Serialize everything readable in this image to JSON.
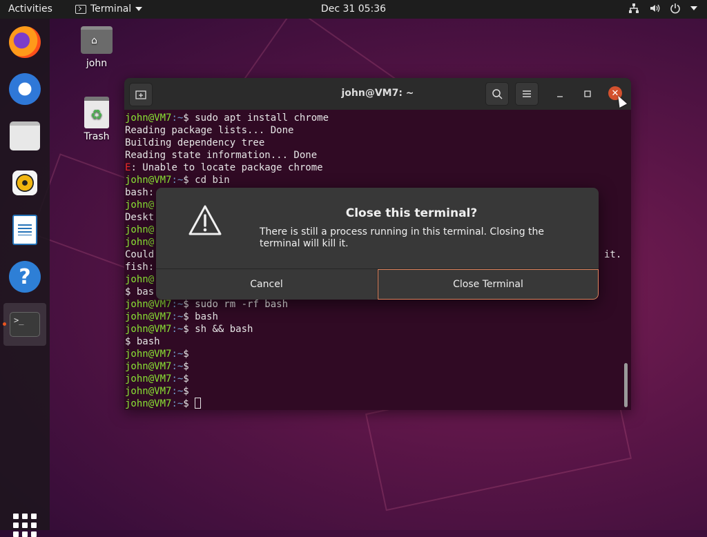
{
  "topbar": {
    "activities": "Activities",
    "app_name": "Terminal",
    "clock": "Dec 31  05:36"
  },
  "dock": {
    "items": [
      "firefox",
      "thunderbird",
      "files",
      "rhythmbox",
      "libreoffice-writer",
      "help",
      "terminal"
    ],
    "terminal_glyph": ">_",
    "help_glyph": "?"
  },
  "desktop": {
    "icons": [
      {
        "label": "john",
        "icon": "home-folder-icon"
      },
      {
        "label": "Trash",
        "icon": "trash-icon"
      }
    ]
  },
  "terminal": {
    "title": "john@VM7: ~",
    "prompt_user": "john@VM7",
    "prompt_path": ":~",
    "lines": [
      {
        "kind": "prompt",
        "cmd": "$ sudo apt install chrome"
      },
      {
        "kind": "out",
        "text": "Reading package lists... Done"
      },
      {
        "kind": "out",
        "text": "Building dependency tree"
      },
      {
        "kind": "out",
        "text": "Reading state information... Done"
      },
      {
        "kind": "err",
        "prefix": "E",
        "text": ": Unable to locate package chrome"
      },
      {
        "kind": "prompt",
        "cmd": "$ cd bin"
      },
      {
        "kind": "out",
        "text": "bash:"
      },
      {
        "kind": "prompt_partial",
        "text": "john@"
      },
      {
        "kind": "out",
        "text": "Deskt"
      },
      {
        "kind": "prompt_partial",
        "text": "john@"
      },
      {
        "kind": "prompt_partial",
        "text": "john@"
      },
      {
        "kind": "out_split",
        "text": "Could",
        "right": "it."
      },
      {
        "kind": "out",
        "text": "fish:"
      },
      {
        "kind": "prompt_partial",
        "text": "john@"
      },
      {
        "kind": "out",
        "text": "$ bas"
      },
      {
        "kind": "prompt",
        "cmd": "$ sudo rm -rf bash"
      },
      {
        "kind": "prompt",
        "cmd": "$ bash"
      },
      {
        "kind": "prompt",
        "cmd": "$ sh && bash"
      },
      {
        "kind": "out",
        "text": "$ bash"
      },
      {
        "kind": "prompt",
        "cmd": "$"
      },
      {
        "kind": "prompt",
        "cmd": "$"
      },
      {
        "kind": "prompt",
        "cmd": "$"
      },
      {
        "kind": "prompt",
        "cmd": "$"
      },
      {
        "kind": "prompt_cursor",
        "cmd": "$ "
      }
    ]
  },
  "dialog": {
    "title": "Close this terminal?",
    "message": "There is still a process running in this terminal. Closing the terminal will kill it.",
    "cancel_label": "Cancel",
    "confirm_label": "Close Terminal",
    "icon": "warning-icon"
  },
  "colors": {
    "prompt_user": "#8ae234",
    "prompt_path": "#729fcf",
    "error": "#ef2929",
    "accent": "#e95420",
    "terminal_bg": "#300a24"
  }
}
